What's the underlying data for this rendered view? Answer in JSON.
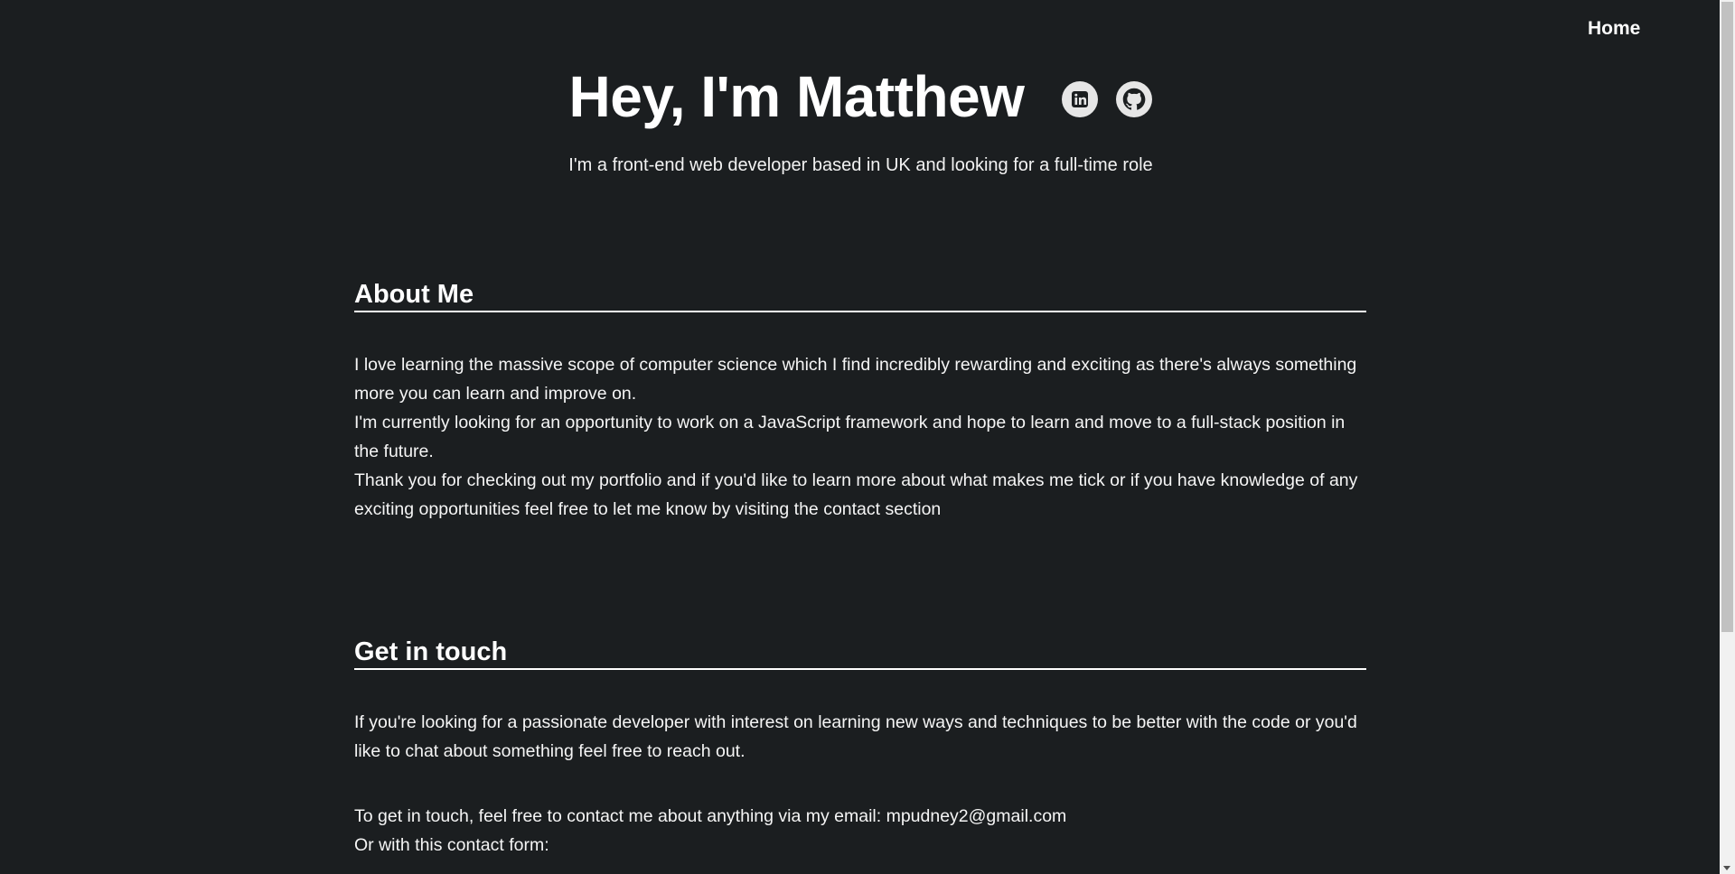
{
  "nav": {
    "home_label": "Home"
  },
  "hero": {
    "title": "Hey, I'm Matthew",
    "subtitle": "I'm a front-end web developer based in UK and looking for a full-time role",
    "social": [
      {
        "icon": "linkedin-icon"
      },
      {
        "icon": "github-icon"
      }
    ]
  },
  "about": {
    "heading": "About Me",
    "paragraphs": [
      "I love learning the massive scope of computer science which I find incredibly rewarding and exciting as there's always something more you can learn and improve on.",
      "I'm currently looking for an opportunity to work on a JavaScript framework and hope to learn and move to a full-stack position in the future.",
      "Thank you for checking out my portfolio and if you'd like to learn more about what makes me tick or if you have knowledge of any exciting opportunities feel free to let me know by visiting the contact section"
    ]
  },
  "contact": {
    "heading": "Get in touch",
    "intro": "If you're looking for a passionate developer with interest on learning new ways and techniques to be better with the code or you'd like to chat about something feel free to reach out.",
    "email_line": "To get in touch, feel free to contact me about anything via my email: mpudney2@gmail.com",
    "form_line": "Or with this contact form:"
  },
  "colors": {
    "background": "#1b1e20",
    "text": "#ffffff",
    "icon_bg": "#e6e6e6"
  }
}
